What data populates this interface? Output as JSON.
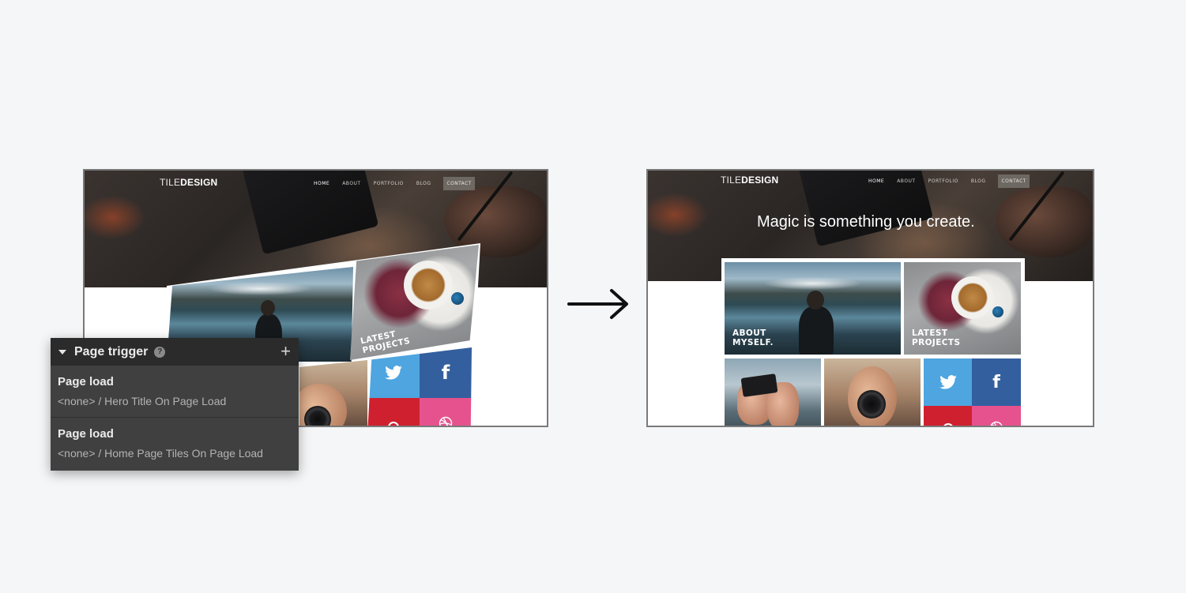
{
  "site": {
    "logo_light": "TILE",
    "logo_bold": "DESIGN",
    "nav": [
      "HOME",
      "ABOUT",
      "PORTFOLIO",
      "BLOG"
    ],
    "nav_contact": "CONTACT",
    "hero_title": "Magic is something you create."
  },
  "tiles": {
    "about_label_line1": "ABOUT",
    "about_label_line2": "MYSELF.",
    "projects_label_line1": "LATEST",
    "projects_label_line2": "PROJECTS"
  },
  "icons": {
    "twitter": "twitter-icon",
    "facebook": "facebook-icon",
    "pinterest": "pinterest-icon",
    "dribbble": "dribbble-icon",
    "arrow": "arrow-right-icon"
  },
  "colors": {
    "background": "#f5f6f8",
    "twitter": "#4ea5df",
    "facebook": "#345f9e",
    "pinterest": "#cf2030",
    "dribbble": "#e6528e",
    "panel": "#404040",
    "panel_header": "#2b2b2b"
  },
  "panel": {
    "title": "Page trigger",
    "help": "?",
    "add": "+",
    "items": [
      {
        "name": "Page load",
        "detail": "<none> / Hero Title On Page Load"
      },
      {
        "name": "Page load",
        "detail": "<none> / Home Page Tiles On Page Load"
      }
    ]
  }
}
